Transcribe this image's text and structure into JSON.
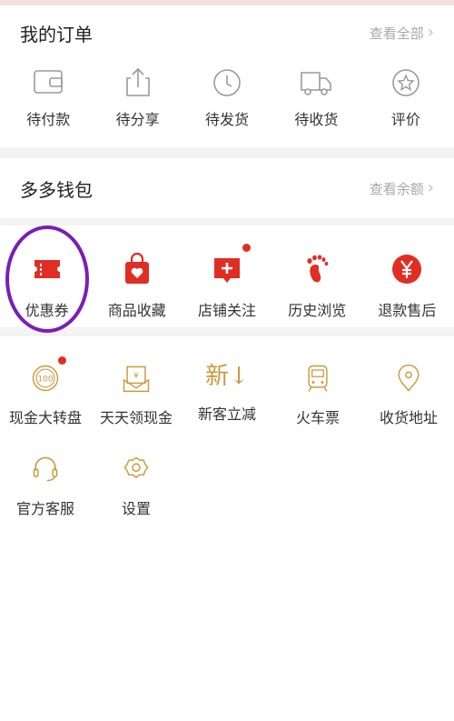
{
  "orders": {
    "title": "我的订单",
    "view_all": "查看全部",
    "items": [
      {
        "label": "待付款",
        "icon": "wallet-icon"
      },
      {
        "label": "待分享",
        "icon": "share-icon"
      },
      {
        "label": "待发货",
        "icon": "clock-icon"
      },
      {
        "label": "待收货",
        "icon": "truck-icon"
      },
      {
        "label": "评价",
        "icon": "star-badge-icon"
      }
    ]
  },
  "wallet": {
    "title": "多多钱包",
    "view_balance": "查看余额"
  },
  "tools": {
    "items": [
      {
        "label": "优惠券",
        "icon": "coupon-icon"
      },
      {
        "label": "商品收藏",
        "icon": "bag-heart-icon"
      },
      {
        "label": "店铺关注",
        "icon": "store-plus-icon"
      },
      {
        "label": "历史浏览",
        "icon": "footprint-icon"
      },
      {
        "label": "退款售后",
        "icon": "yen-circle-icon"
      }
    ]
  },
  "services": {
    "row1": [
      {
        "label": "现金大转盘",
        "icon": "cash-wheel-icon"
      },
      {
        "label": "天天领现金",
        "icon": "red-packet-icon"
      },
      {
        "label": "新客立减",
        "icon": "new-customer-icon",
        "glyph": "新↓"
      },
      {
        "label": "火车票",
        "icon": "train-icon"
      },
      {
        "label": "收货地址",
        "icon": "location-icon"
      }
    ],
    "row2": [
      {
        "label": "官方客服",
        "icon": "headset-icon"
      },
      {
        "label": "设置",
        "icon": "settings-icon"
      }
    ]
  },
  "colors": {
    "accent_red": "#e02e24",
    "gold": "#c99a3c",
    "gray_icon": "#9a9a9a",
    "highlight": "#7a1fb5"
  }
}
